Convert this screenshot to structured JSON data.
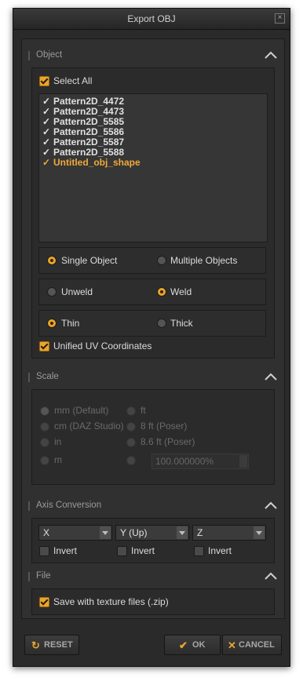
{
  "window": {
    "title": "Export OBJ",
    "close": "×"
  },
  "sections": {
    "object": {
      "label": "Object"
    },
    "scale": {
      "label": "Scale"
    },
    "axis": {
      "label": "Axis Conversion"
    },
    "file": {
      "label": "File"
    }
  },
  "object": {
    "select_all": "Select All",
    "items": [
      "Pattern2D_4472",
      "Pattern2D_4473",
      "Pattern2D_5585",
      "Pattern2D_5586",
      "Pattern2D_5587",
      "Pattern2D_5588",
      "Untitled_obj_shape"
    ],
    "single": "Single Object",
    "multiple": "Multiple Objects",
    "unweld": "Unweld",
    "weld": "Weld",
    "thin": "Thin",
    "thick": "Thick",
    "unified_uv": "Unified UV Coordinates"
  },
  "scale": {
    "mm": "mm (Default)",
    "cm": "cm (DAZ Studio)",
    "in": "in",
    "m": "m",
    "ft": "ft",
    "ft8": "8 ft (Poser)",
    "ft86": "8.6 ft (Poser)",
    "custom_value": "100.000000%"
  },
  "axis": {
    "x": "X",
    "y": "Y (Up)",
    "z": "Z",
    "invert": "Invert"
  },
  "file": {
    "save_zip": "Save with texture files (.zip)"
  },
  "buttons": {
    "reset": "RESET",
    "ok": "OK",
    "cancel": "CANCEL"
  },
  "colors": {
    "accent": "#e9a52e",
    "selected_item": "#f0a93a"
  }
}
